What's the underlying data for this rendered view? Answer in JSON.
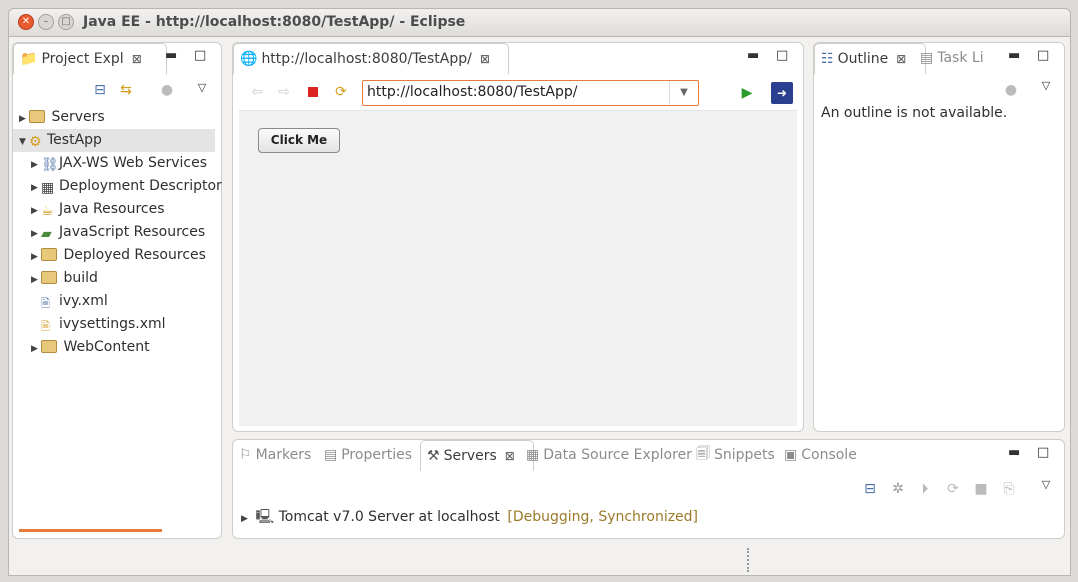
{
  "window": {
    "title": "Java EE - http://localhost:8080/TestApp/ - Eclipse"
  },
  "project_explorer": {
    "tab_label": "Project Expl",
    "items": [
      {
        "label": "Servers"
      },
      {
        "label": "TestApp"
      },
      {
        "label": "JAX-WS Web Services"
      },
      {
        "label": "Deployment Descriptor"
      },
      {
        "label": "Java Resources"
      },
      {
        "label": "JavaScript Resources"
      },
      {
        "label": "Deployed Resources"
      },
      {
        "label": "build"
      },
      {
        "label": "ivy.xml"
      },
      {
        "label": "ivysettings.xml"
      },
      {
        "label": "WebContent"
      }
    ]
  },
  "browser": {
    "tab_label": "http://localhost:8080/TestApp/",
    "url": "http://localhost:8080/TestApp/",
    "page_button": "Click Me"
  },
  "outline": {
    "tab_label": "Outline",
    "tab2_label": "Task Li",
    "message": "An outline is not available."
  },
  "bottom": {
    "tabs": [
      "Markers",
      "Properties",
      "Servers",
      "Data Source Explorer",
      "Snippets",
      "Console"
    ],
    "server_name": "Tomcat v7.0 Server at localhost",
    "server_state": "[Debugging, Synchronized]"
  },
  "colors": {
    "server_state": "#9c7a2a",
    "accent": "#e57c3e"
  }
}
